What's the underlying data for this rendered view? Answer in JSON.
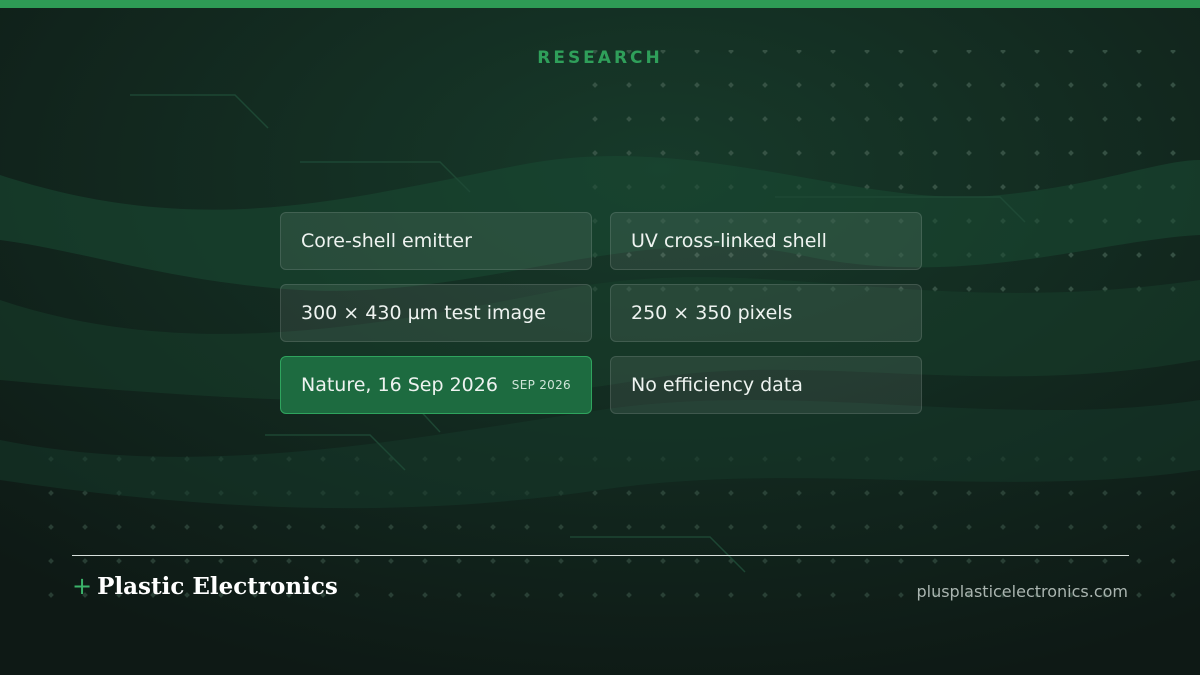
{
  "header": {
    "kicker": "RESEARCH"
  },
  "cards": [
    {
      "label": "Core-shell emitter",
      "tag": ""
    },
    {
      "label": "UV cross-linked shell",
      "tag": ""
    },
    {
      "label": "300 × 430 µm test image",
      "tag": ""
    },
    {
      "label": "250 × 350 pixels",
      "tag": ""
    },
    {
      "label": "Nature, 16 Sep 2026",
      "tag": "SEP 2026"
    },
    {
      "label": "No efficiency data",
      "tag": ""
    }
  ],
  "footer": {
    "plus": "+",
    "brand": "Plastic Electronics",
    "url": "plusplasticelectronics.com"
  },
  "colors": {
    "accent": "#2e9b55",
    "background": "#0f1b16",
    "active_card": "#1d6b40"
  }
}
